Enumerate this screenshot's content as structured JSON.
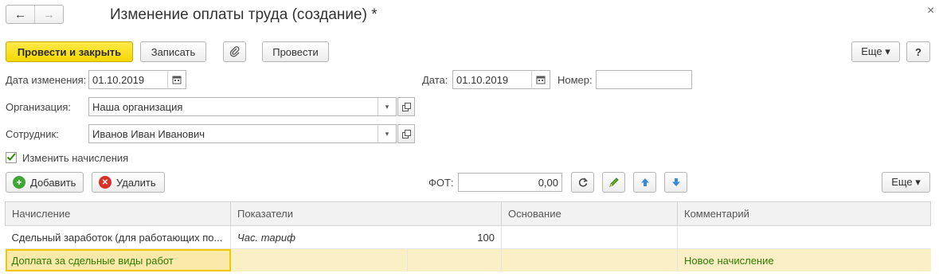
{
  "window": {
    "title": "Изменение оплаты труда (создание) *",
    "back_glyph": "←",
    "forward_glyph": "→",
    "close_glyph": "×"
  },
  "toolbar": {
    "post_close_label": "Провести и закрыть",
    "write_label": "Записать",
    "attach_glyph": "📎",
    "post_label": "Провести",
    "more_label": "Еще ▾",
    "help_label": "?"
  },
  "form": {
    "change_date_label": "Дата изменения:",
    "change_date_value": "01.10.2019",
    "date_label": "Дата:",
    "date_value": "01.10.2019",
    "number_label": "Номер:",
    "number_value": "",
    "org_label": "Организация:",
    "org_value": "Наша организация",
    "employee_label": "Сотрудник:",
    "employee_value": "Иванов Иван Иванович",
    "change_accruals_label": "Изменить начисления",
    "change_accruals_checked": true
  },
  "table_toolbar": {
    "add_label": "Добавить",
    "delete_label": "Удалить",
    "fot_label": "ФОТ:",
    "fot_value": "0,00",
    "more_label": "Еще ▾"
  },
  "table": {
    "columns": [
      "Начисление",
      "Показатели",
      "Основание",
      "Комментарий"
    ],
    "rows": [
      {
        "accrual": "Сдельный заработок (для работающих по...",
        "indicator": "Час. тариф",
        "indicator_value": "100",
        "basis": "",
        "comment": ""
      },
      {
        "accrual": "Доплата за сдельные виды работ",
        "indicator": "",
        "indicator_value": "",
        "basis": "",
        "comment": "Новое начисление"
      }
    ]
  },
  "colors": {
    "primary_button": "#f5d800",
    "selected_row": "#fbf0c5",
    "new_text": "#2f7a00"
  }
}
